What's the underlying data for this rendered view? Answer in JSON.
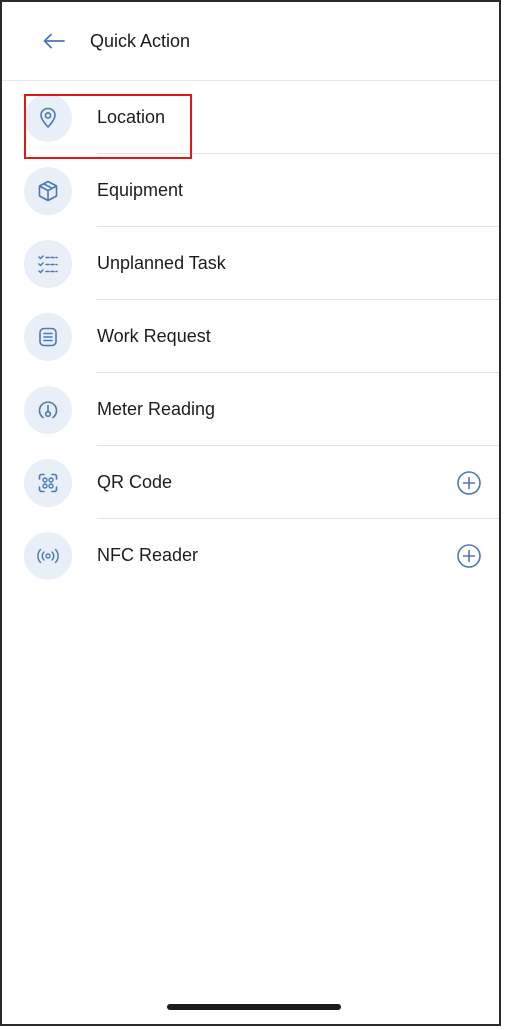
{
  "header": {
    "title": "Quick Action",
    "back_icon": "arrow-left-icon"
  },
  "items": [
    {
      "label": "Location",
      "icon": "location-pin-icon",
      "add": false,
      "highlighted": true
    },
    {
      "label": "Equipment",
      "icon": "cube-icon",
      "add": false,
      "highlighted": false
    },
    {
      "label": "Unplanned Task",
      "icon": "checklist-icon",
      "add": false,
      "highlighted": false
    },
    {
      "label": "Work Request",
      "icon": "list-document-icon",
      "add": false,
      "highlighted": false
    },
    {
      "label": "Meter Reading",
      "icon": "gauge-icon",
      "add": false,
      "highlighted": false
    },
    {
      "label": "QR Code",
      "icon": "qr-scan-icon",
      "add": true,
      "highlighted": false
    },
    {
      "label": "NFC Reader",
      "icon": "nfc-icon",
      "add": true,
      "highlighted": false
    }
  ],
  "colors": {
    "accent": "#4a78b5",
    "icon_bg": "#e8eff8",
    "highlight": "#e01818"
  }
}
